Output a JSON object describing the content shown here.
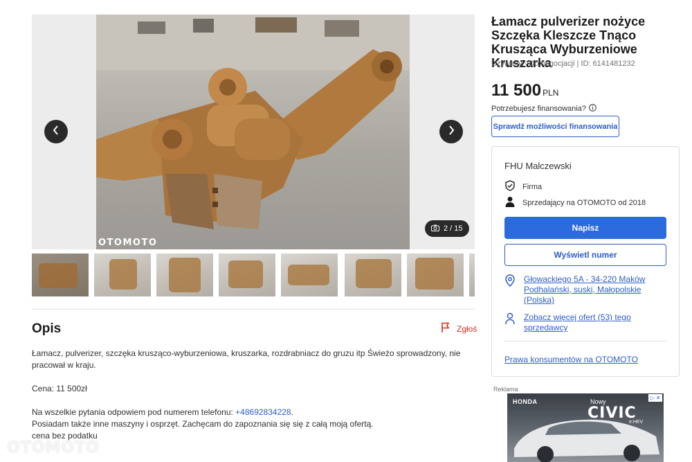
{
  "gallery": {
    "watermark": "OTOMOTO",
    "counter": "2 / 15",
    "thumbnail_count": 7
  },
  "listing": {
    "title": "Łamacz pulverizer nożyce Szczęka Kleszcze Tnąco Krusząca Wyburzeniowe Kruszarka",
    "meta": "Używany · Do negocjacji | ID: 6141481232",
    "price": "11 500",
    "currency": "PLN",
    "financing_question": "Potrzebujesz finansowania?",
    "financing_button": "Sprawdź możliwości finansowania"
  },
  "seller": {
    "name": "FHU Malczewski",
    "type": "Firma",
    "since": "Sprzedający na OTOMOTO od 2018",
    "write_button": "Napisz",
    "phone_button": "Wyświetl numer",
    "address": "Głowackiego 5A - 34-220 Maków Podhalański, suski, Małopolskie (Polska)",
    "more_offers": "Zobacz więcej ofert (53) tego sprzedawcy",
    "consumer_rights": "Prawa konsumentów na OTOMOTO"
  },
  "description": {
    "heading": "Opis",
    "report": "Zgłoś",
    "line1": "Łamacz, pulverizer, szczęka krusząco-wyburzeniowa, kruszarka, rozdrabniacz do gruzu itp Świeżo sprowadzony, nie pracował w kraju.",
    "line2": "Cena: 11 500zł",
    "line3_prefix": "Na wszelkie pytania odpowiem pod numerem telefonu: ",
    "phone": "+48692834228",
    "line3_suffix": ".",
    "line4": "Posiadam także inne maszyny i osprzęt. Zachęcam do zapoznania się się z całą moją ofertą.",
    "line5": "cena bez podatku"
  },
  "ad": {
    "label": "Reklama",
    "brand": "HONDA",
    "nowy": "Nowy",
    "model": "CIVIC",
    "variant": "e:HEV"
  },
  "site_watermark": "OTOMOTO",
  "colors": {
    "accent": "#2c6bdc",
    "link": "#2c5dc9",
    "report": "#d9291c"
  }
}
